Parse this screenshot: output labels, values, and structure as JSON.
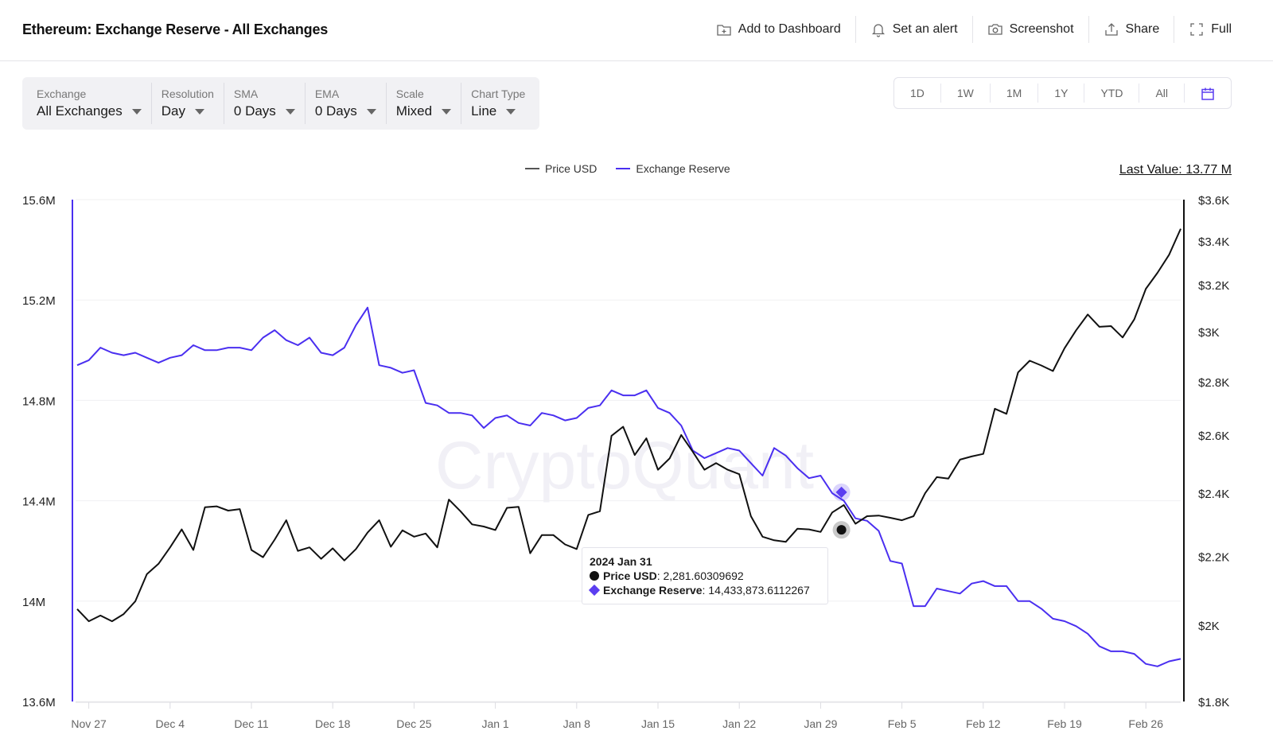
{
  "header": {
    "title": "Ethereum: Exchange Reserve - All Exchanges",
    "actions": [
      {
        "label": "Add to Dashboard",
        "icon": "folder-plus-icon"
      },
      {
        "label": "Set an alert",
        "icon": "bell-icon"
      },
      {
        "label": "Screenshot",
        "icon": "camera-icon"
      },
      {
        "label": "Share",
        "icon": "share-icon"
      },
      {
        "label": "Full",
        "icon": "fullscreen-icon"
      }
    ]
  },
  "filters": [
    {
      "label": "Exchange",
      "value": "All Exchanges"
    },
    {
      "label": "Resolution",
      "value": "Day"
    },
    {
      "label": "SMA",
      "value": "0 Days"
    },
    {
      "label": "EMA",
      "value": "0 Days"
    },
    {
      "label": "Scale",
      "value": "Mixed"
    },
    {
      "label": "Chart Type",
      "value": "Line"
    }
  ],
  "ranges": [
    "1D",
    "1W",
    "1M",
    "1Y",
    "YTD",
    "All"
  ],
  "last_value": "Last Value: 13.77 M",
  "watermark": "CryptoQuant",
  "tooltip": {
    "date": "2024 Jan 31",
    "price_label": "Price USD",
    "price_value": ": 2,281.60309692",
    "reserve_label": "Exchange Reserve",
    "reserve_value": ": 14,433,873.6112267"
  },
  "colors": {
    "price": "#111111",
    "reserve": "#4a2ff0",
    "accent": "#5b3ef0"
  },
  "chart_data": {
    "type": "line",
    "title": "Ethereum: Exchange Reserve - All Exchanges",
    "start_date": "2023-11-26",
    "x_tick_labels": [
      "Nov 27",
      "Dec 4",
      "Dec 11",
      "Dec 18",
      "Dec 25",
      "Jan 1",
      "Jan 8",
      "Jan 15",
      "Jan 22",
      "Jan 29",
      "Feb 5",
      "Feb 12",
      "Feb 19",
      "Feb 26"
    ],
    "x_tick_day_offsets": [
      1,
      8,
      15,
      22,
      29,
      36,
      43,
      50,
      57,
      64,
      71,
      78,
      85,
      92
    ],
    "left_axis": {
      "label": "Exchange Reserve",
      "ticks": [
        "13.6M",
        "14M",
        "14.4M",
        "14.8M",
        "15.2M",
        "15.6M"
      ],
      "tick_values": [
        13.6,
        14.0,
        14.4,
        14.8,
        15.2,
        15.6
      ],
      "range": [
        13.6,
        15.6
      ],
      "scale": "linear",
      "unit": "M"
    },
    "right_axis": {
      "label": "Price USD",
      "ticks": [
        "$1.8K",
        "$2K",
        "$2.2K",
        "$2.4K",
        "$2.6K",
        "$2.8K",
        "$3K",
        "$3.2K",
        "$3.4K",
        "$3.6K"
      ],
      "tick_values": [
        1800,
        2000,
        2200,
        2400,
        2600,
        2800,
        3000,
        3200,
        3400,
        3600
      ],
      "range": [
        1800,
        3600
      ],
      "scale": "log"
    },
    "legend": {
      "placement": "top-center",
      "entries": [
        "Price USD",
        "Exchange Reserve"
      ]
    },
    "series": [
      {
        "name": "Price USD",
        "axis": "right",
        "values": [
          2045,
          2011,
          2027,
          2011,
          2031,
          2067,
          2146,
          2177,
          2227,
          2283,
          2219,
          2354,
          2357,
          2343,
          2348,
          2219,
          2197,
          2251,
          2312,
          2216,
          2227,
          2192,
          2224,
          2187,
          2222,
          2273,
          2312,
          2229,
          2280,
          2260,
          2270,
          2227,
          2379,
          2341,
          2299,
          2292,
          2281,
          2352,
          2355,
          2209,
          2265,
          2265,
          2236,
          2222,
          2329,
          2341,
          2598,
          2631,
          2530,
          2589,
          2479,
          2518,
          2601,
          2541,
          2479,
          2502,
          2479,
          2464,
          2325,
          2260,
          2249,
          2244,
          2285,
          2283,
          2275,
          2337,
          2361,
          2301,
          2325,
          2327,
          2320,
          2312,
          2325,
          2400,
          2454,
          2449,
          2514,
          2525,
          2534,
          2697,
          2678,
          2836,
          2882,
          2863,
          2841,
          2932,
          3006,
          3072,
          3020,
          3023,
          2976,
          3051,
          3183,
          3254,
          3336,
          3458
        ]
      },
      {
        "name": "Exchange Reserve",
        "axis": "left",
        "values": [
          14.94,
          14.96,
          15.01,
          14.99,
          14.98,
          14.99,
          14.97,
          14.95,
          14.97,
          14.98,
          15.02,
          15.0,
          15.0,
          15.01,
          15.01,
          15.0,
          15.05,
          15.08,
          15.04,
          15.02,
          15.05,
          14.99,
          14.98,
          15.01,
          15.1,
          15.17,
          14.94,
          14.93,
          14.91,
          14.92,
          14.79,
          14.78,
          14.75,
          14.75,
          14.74,
          14.69,
          14.73,
          14.74,
          14.71,
          14.7,
          14.75,
          14.74,
          14.72,
          14.73,
          14.77,
          14.78,
          14.84,
          14.82,
          14.82,
          14.84,
          14.77,
          14.75,
          14.7,
          14.6,
          14.57,
          14.59,
          14.61,
          14.6,
          14.55,
          14.5,
          14.61,
          14.58,
          14.53,
          14.49,
          14.5,
          14.43,
          14.4,
          14.33,
          14.32,
          14.28,
          14.16,
          14.15,
          13.98,
          13.98,
          14.05,
          14.04,
          14.03,
          14.07,
          14.08,
          14.06,
          14.06,
          14.0,
          14.0,
          13.97,
          13.93,
          13.92,
          13.9,
          13.87,
          13.82,
          13.8,
          13.8,
          13.79,
          13.75,
          13.74,
          13.76,
          13.77
        ]
      }
    ],
    "highlight": {
      "day_offset": 66,
      "date": "2024 Jan 31",
      "price": 2281.60309692,
      "reserve": 14.4338736112267
    }
  }
}
